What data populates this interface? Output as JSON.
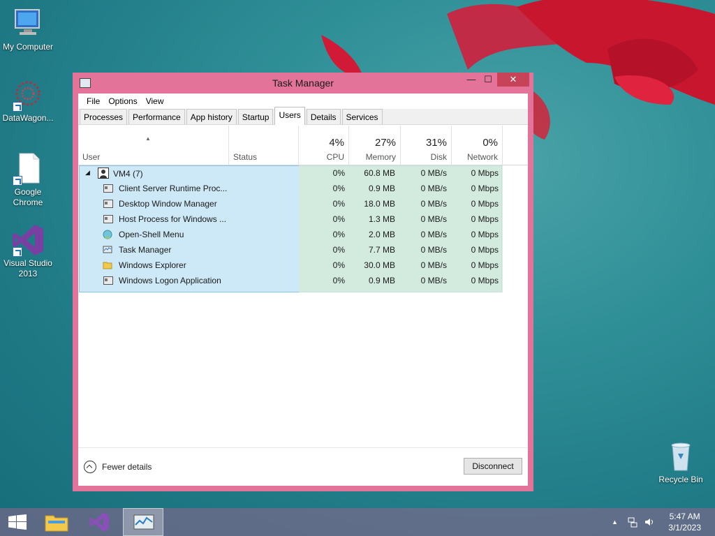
{
  "desktop": {
    "icons": [
      {
        "label": "My Computer"
      },
      {
        "label": "DataWagon..."
      },
      {
        "label": "Google Chrome"
      },
      {
        "label": "Visual Studio 2013"
      },
      {
        "label": "Recycle Bin"
      }
    ]
  },
  "window": {
    "title": "Task Manager",
    "controls": {
      "minimize": "—",
      "maximize": "☐",
      "close": "✕"
    }
  },
  "menu": [
    "File",
    "Options",
    "View"
  ],
  "tabs": [
    "Processes",
    "Performance",
    "App history",
    "Startup",
    "Users",
    "Details",
    "Services"
  ],
  "active_tab": "Users",
  "columns": {
    "user": "User",
    "status": "Status",
    "cpu": {
      "pct": "4%",
      "label": "CPU"
    },
    "memory": {
      "pct": "27%",
      "label": "Memory"
    },
    "disk": {
      "pct": "31%",
      "label": "Disk"
    },
    "network": {
      "pct": "0%",
      "label": "Network"
    }
  },
  "user_row": {
    "name": "VM4 (7)",
    "cpu": "0%",
    "memory": "60.8 MB",
    "disk": "0 MB/s",
    "network": "0 Mbps"
  },
  "processes": [
    {
      "name": "Client Server Runtime Proc...",
      "cpu": "0%",
      "memory": "0.9 MB",
      "disk": "0 MB/s",
      "network": "0 Mbps"
    },
    {
      "name": "Desktop Window Manager",
      "cpu": "0%",
      "memory": "18.0 MB",
      "disk": "0 MB/s",
      "network": "0 Mbps"
    },
    {
      "name": "Host Process for Windows ...",
      "cpu": "0%",
      "memory": "1.3 MB",
      "disk": "0 MB/s",
      "network": "0 Mbps"
    },
    {
      "name": "Open-Shell Menu",
      "cpu": "0%",
      "memory": "2.0 MB",
      "disk": "0 MB/s",
      "network": "0 Mbps"
    },
    {
      "name": "Task Manager",
      "cpu": "0%",
      "memory": "7.7 MB",
      "disk": "0 MB/s",
      "network": "0 Mbps"
    },
    {
      "name": "Windows Explorer",
      "cpu": "0%",
      "memory": "30.0 MB",
      "disk": "0 MB/s",
      "network": "0 Mbps"
    },
    {
      "name": "Windows Logon Application",
      "cpu": "0%",
      "memory": "0.9 MB",
      "disk": "0 MB/s",
      "network": "0 Mbps"
    }
  ],
  "footer": {
    "fewer_details": "Fewer details",
    "disconnect": "Disconnect"
  },
  "taskbar": {
    "time": "5:47 AM",
    "date": "3/1/2023"
  },
  "colors": {
    "window_frame": "#e4739a",
    "selection": "#cde8f6",
    "close_button": "#c7435a"
  }
}
